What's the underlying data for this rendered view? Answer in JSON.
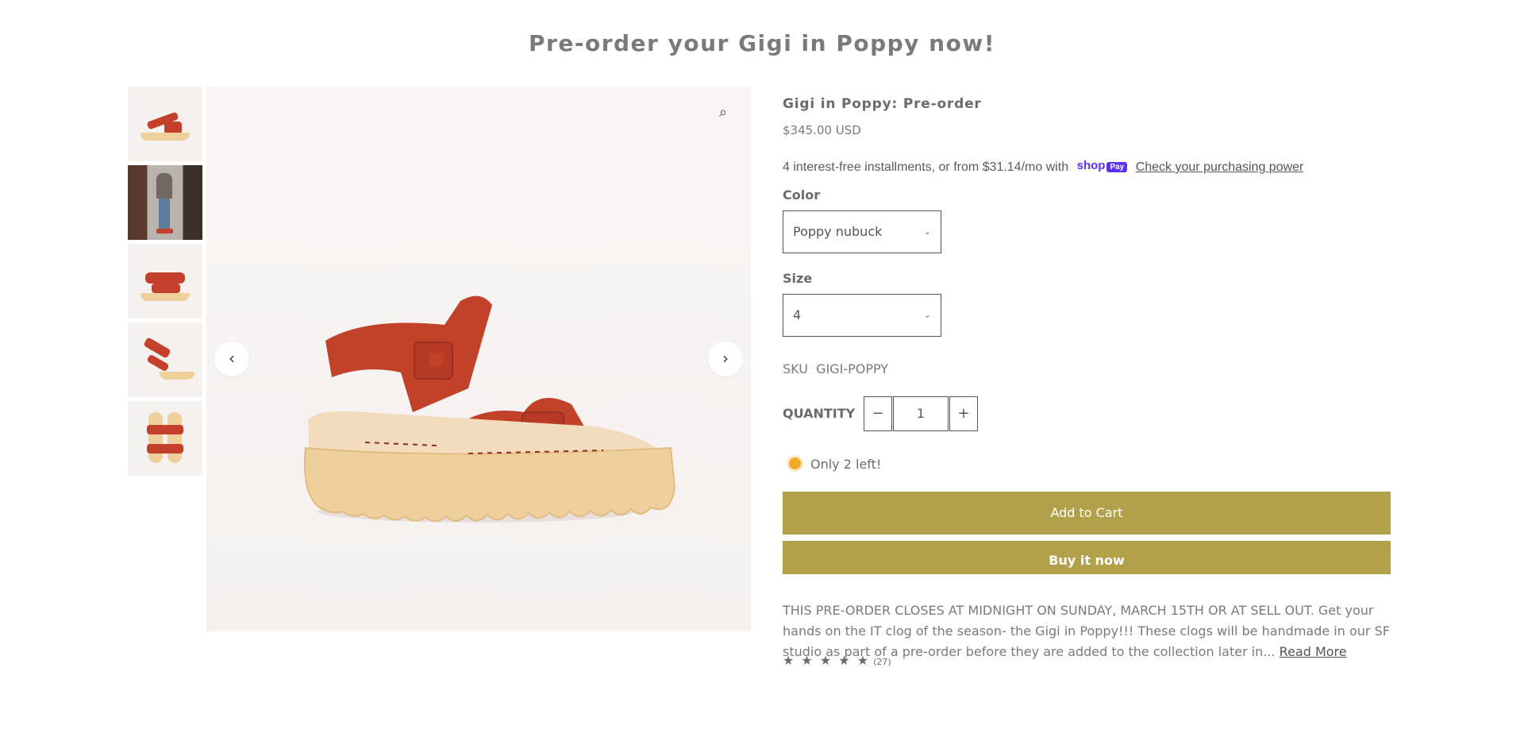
{
  "banner": {
    "title": "Pre-order your Gigi in Poppy now!"
  },
  "product": {
    "title": "Gigi in Poppy: Pre-order",
    "price": "$345.00 USD",
    "installments": {
      "text": "4 interest-free installments, or from $31.14/mo with",
      "shop_logo": "shop",
      "pay_logo": "Pay",
      "link": "Check your purchasing power"
    },
    "color": {
      "label": "Color",
      "selected": "Poppy nubuck"
    },
    "size": {
      "label": "Size",
      "selected": "4"
    },
    "sku": {
      "label": "SKU",
      "value": "GIGI-POPPY"
    },
    "quantity": {
      "label": "QUANTITY",
      "value": "1",
      "minus": "−",
      "plus": "+"
    },
    "stock": "Only 2 left!",
    "add_to_cart": "Add to Cart",
    "buy_now": "Buy it now",
    "description": "THIS PRE-ORDER CLOSES AT MIDNIGHT ON SUNDAY, MARCH 15TH OR AT SELL OUT. Get your hands on the IT clog of the season- the Gigi in Poppy!!! These clogs will be handmade in our SF studio as part of a pre-order before they are added to the collection later in...",
    "read_more": "Read More",
    "rating": {
      "stars": "★ ★ ★ ★ ★",
      "count": "(27)"
    }
  },
  "gallery": {
    "icons": {
      "zoom": "zoom-icon",
      "prev": "chevron-left-icon",
      "next": "chevron-right-icon"
    },
    "prev_glyph": "‹",
    "next_glyph": "›",
    "zoom_glyph": "⌕"
  },
  "colors": {
    "accent": "#b3a04b",
    "strap": "#c4402a",
    "sole": "#efcf9c",
    "stock_dot": "#f0a92b",
    "shop_pay": "#5a31f4"
  }
}
